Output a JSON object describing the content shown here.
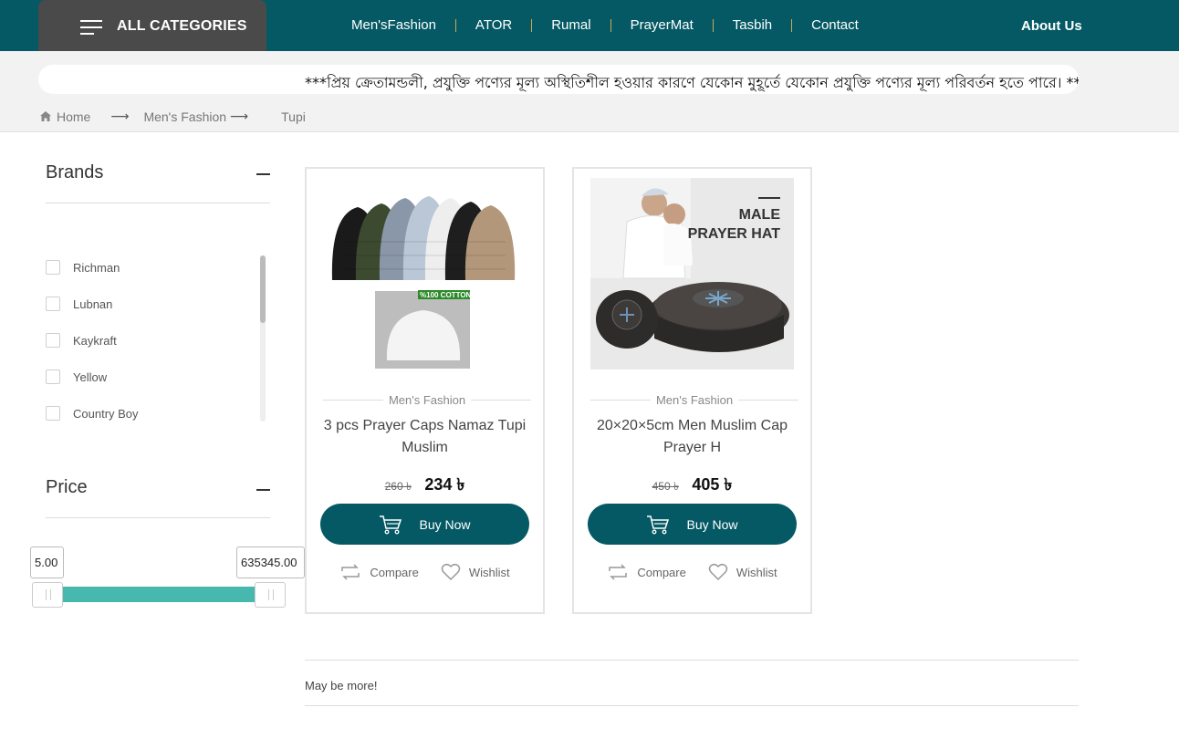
{
  "nav": {
    "all_categories": "ALL CATEGORIES",
    "links": [
      "Men'sFashion",
      "ATOR",
      "Rumal",
      "PrayerMat",
      "Tasbih",
      "Contact"
    ],
    "about": "About Us",
    "colors": {
      "primary": "#055964",
      "category_bg": "#4a4a4a",
      "slider": "#46b8ad"
    }
  },
  "notice": "***প্রিয় ক্রেতামন্ডলী, প্রযুক্তি পণ্যের মূল্য অস্থিতিশীল হওয়ার কারণে যেকোন মুহূর্তে যেকোন প্রযুক্তি পণ্যের মূল্য পরিবর্তন হতে পারে। ***",
  "breadcrumb": [
    "Home",
    "Men's Fashion",
    "Tupi"
  ],
  "sidebar": {
    "brands_title": "Brands",
    "brands": [
      "Richman",
      "Lubnan",
      "Kaykraft",
      "Yellow",
      "Country Boy"
    ],
    "price_title": "Price",
    "price_min": "5.00",
    "price_max": "635345.00"
  },
  "products": [
    {
      "category": "Men's Fashion",
      "name": "3 pcs Prayer Caps Namaz Tupi Muslim",
      "old_price": "260 ৳",
      "price": "234 ৳",
      "buy": "Buy Now",
      "compare": "Compare",
      "wishlist": "Wishlist",
      "badge": "%100 COTTON"
    },
    {
      "category": "Men's Fashion",
      "name": "20×20×5cm Men Muslim Cap Prayer H",
      "old_price": "450 ৳",
      "price": "405 ৳",
      "buy": "Buy Now",
      "compare": "Compare",
      "wishlist": "Wishlist",
      "image_text": "MALE PRAYER HAT"
    }
  ],
  "more": "May be more!"
}
